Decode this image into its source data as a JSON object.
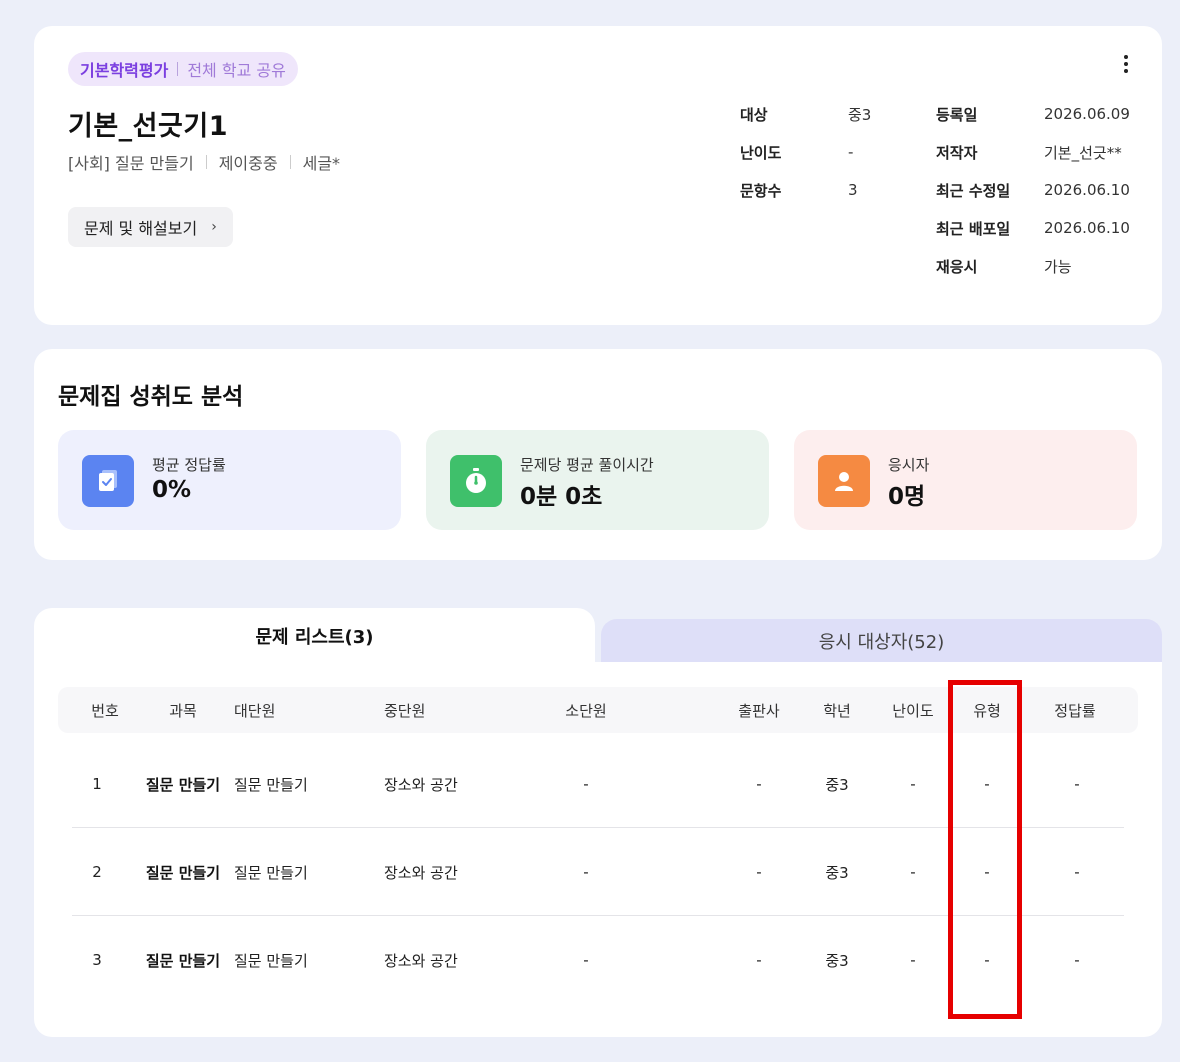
{
  "header": {
    "badge_primary": "기본학력평가",
    "badge_secondary": "전체 학교 공유",
    "title": "기본_선긋기1",
    "tags": [
      "[사회] 질문 만들기",
      "제이중중",
      "세글*"
    ],
    "view_button": "문제 및 해설보기",
    "meta_left": [
      {
        "label": "대상",
        "value": "중3"
      },
      {
        "label": "난이도",
        "value": "-"
      },
      {
        "label": "문항수",
        "value": "3"
      }
    ],
    "meta_right": [
      {
        "label": "등록일",
        "value": "2026.06.09"
      },
      {
        "label": "저작자",
        "value": "기본_선긋**"
      },
      {
        "label": "최근 수정일",
        "value": "2026.06.10"
      },
      {
        "label": "최근 배포일",
        "value": "2026.06.10"
      },
      {
        "label": "재응시",
        "value": "가능"
      }
    ]
  },
  "analysis": {
    "title": "문제집 성취도 분석",
    "stats": [
      {
        "label": "평균 정답률",
        "value": "0%",
        "icon": "document-check-icon",
        "color": "#5b84f1"
      },
      {
        "label": "문제당 평균 풀이시간",
        "value": "0분 0초",
        "icon": "stopwatch-icon",
        "color": "#3fc06b"
      },
      {
        "label": "응시자",
        "value": "0명",
        "icon": "person-icon",
        "color": "#f58a42"
      }
    ]
  },
  "tabs": {
    "active": "문제 리스트(3)",
    "inactive": "응시 대상자(52)"
  },
  "table": {
    "columns": [
      "번호",
      "과목",
      "대단원",
      "중단원",
      "소단원",
      "출판사",
      "학년",
      "난이도",
      "유형",
      "정답률"
    ],
    "rows": [
      [
        "1",
        "질문 만들기",
        "질문 만들기",
        "장소와 공간",
        "-",
        "-",
        "중3",
        "-",
        "-",
        "-"
      ],
      [
        "2",
        "질문 만들기",
        "질문 만들기",
        "장소와 공간",
        "-",
        "-",
        "중3",
        "-",
        "-",
        "-"
      ],
      [
        "3",
        "질문 만들기",
        "질문 만들기",
        "장소와 공간",
        "-",
        "-",
        "중3",
        "-",
        "-",
        "-"
      ]
    ]
  },
  "colors": {
    "highlight": "#e60000",
    "badge_text": "#7b3fe0",
    "background": "#eceff9"
  }
}
